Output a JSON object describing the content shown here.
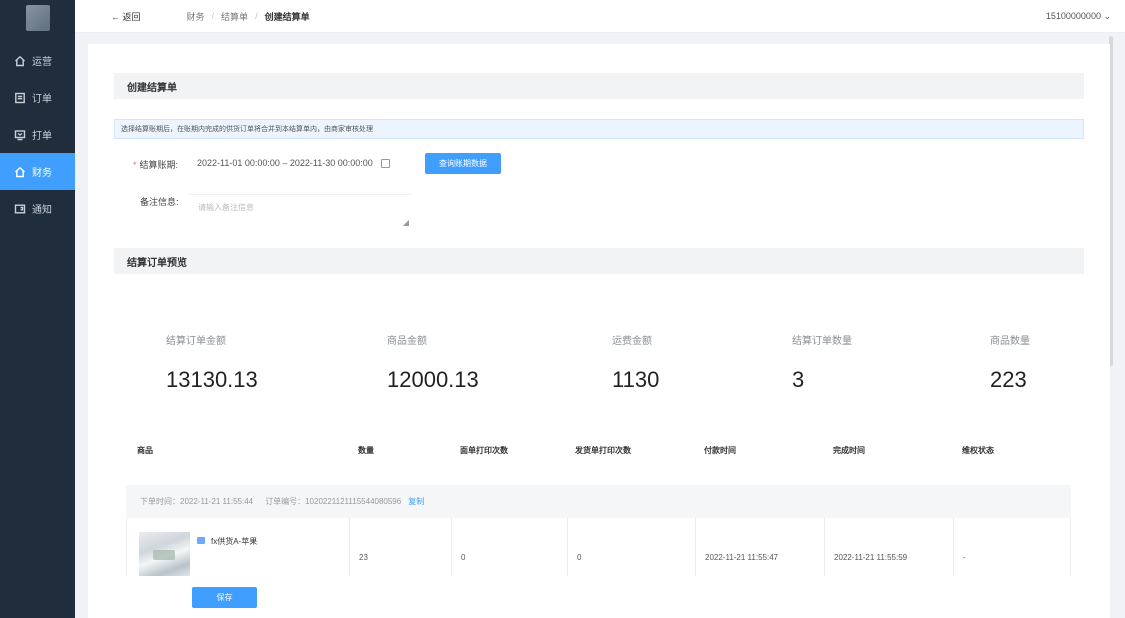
{
  "sidebar": {
    "items": [
      {
        "label": "运营",
        "icon": "home-icon",
        "active": false
      },
      {
        "label": "订单",
        "icon": "order-list-icon",
        "active": false
      },
      {
        "label": "打单",
        "icon": "printer-icon",
        "active": false
      },
      {
        "label": "财务",
        "icon": "home-icon",
        "active": true
      },
      {
        "label": "通知",
        "icon": "notification-icon",
        "active": false
      }
    ]
  },
  "header": {
    "back": "← 返回",
    "breadcrumb": [
      "财务",
      "结算单",
      "创建结算单"
    ],
    "user": "15100000000 ⌄"
  },
  "form": {
    "section_title": "创建结算单",
    "notice": "选择结算账期后，在账期内完成的供货订单将合并到本结算单内，由商家审核处理",
    "period_label": "结算账期:",
    "period_required": "*",
    "period_value": "2022-11-01 00:00:00 – 2022-11-30 00:00:00",
    "query_button": "查询账期数据",
    "remark_label": "备注信息:",
    "remark_placeholder": "请输入备注信息"
  },
  "preview": {
    "section_title": "结算订单预览",
    "stats": [
      {
        "label": "结算订单金额",
        "value": "13130.13"
      },
      {
        "label": "商品金额",
        "value": "12000.13"
      },
      {
        "label": "运费金额",
        "value": "1130"
      },
      {
        "label": "结算订单数量",
        "value": "3"
      },
      {
        "label": "商品数量",
        "value": "223"
      }
    ]
  },
  "table": {
    "columns": [
      "商品",
      "数量",
      "面单打印次数",
      "发货单打印次数",
      "付款时间",
      "完成时间",
      "维权状态"
    ],
    "order": {
      "order_time": "下单时间：2022-11-21 11:55:44",
      "order_no": "订单编号：10202211211155440805​96",
      "copy": "复制",
      "product": "fx供货A-苹果",
      "quantity": "23",
      "waybill_prints": "0",
      "invoice_prints": "0",
      "pay_time": "2022-11-21 11:55:47",
      "finish_time": "2022-11-21 11:55:59",
      "rights_status": "-"
    }
  },
  "footer": {
    "save": "保存"
  },
  "colors": {
    "sidebar_bg": "#1f2d3d",
    "primary": "#409eff",
    "required": "#f56c6c"
  }
}
